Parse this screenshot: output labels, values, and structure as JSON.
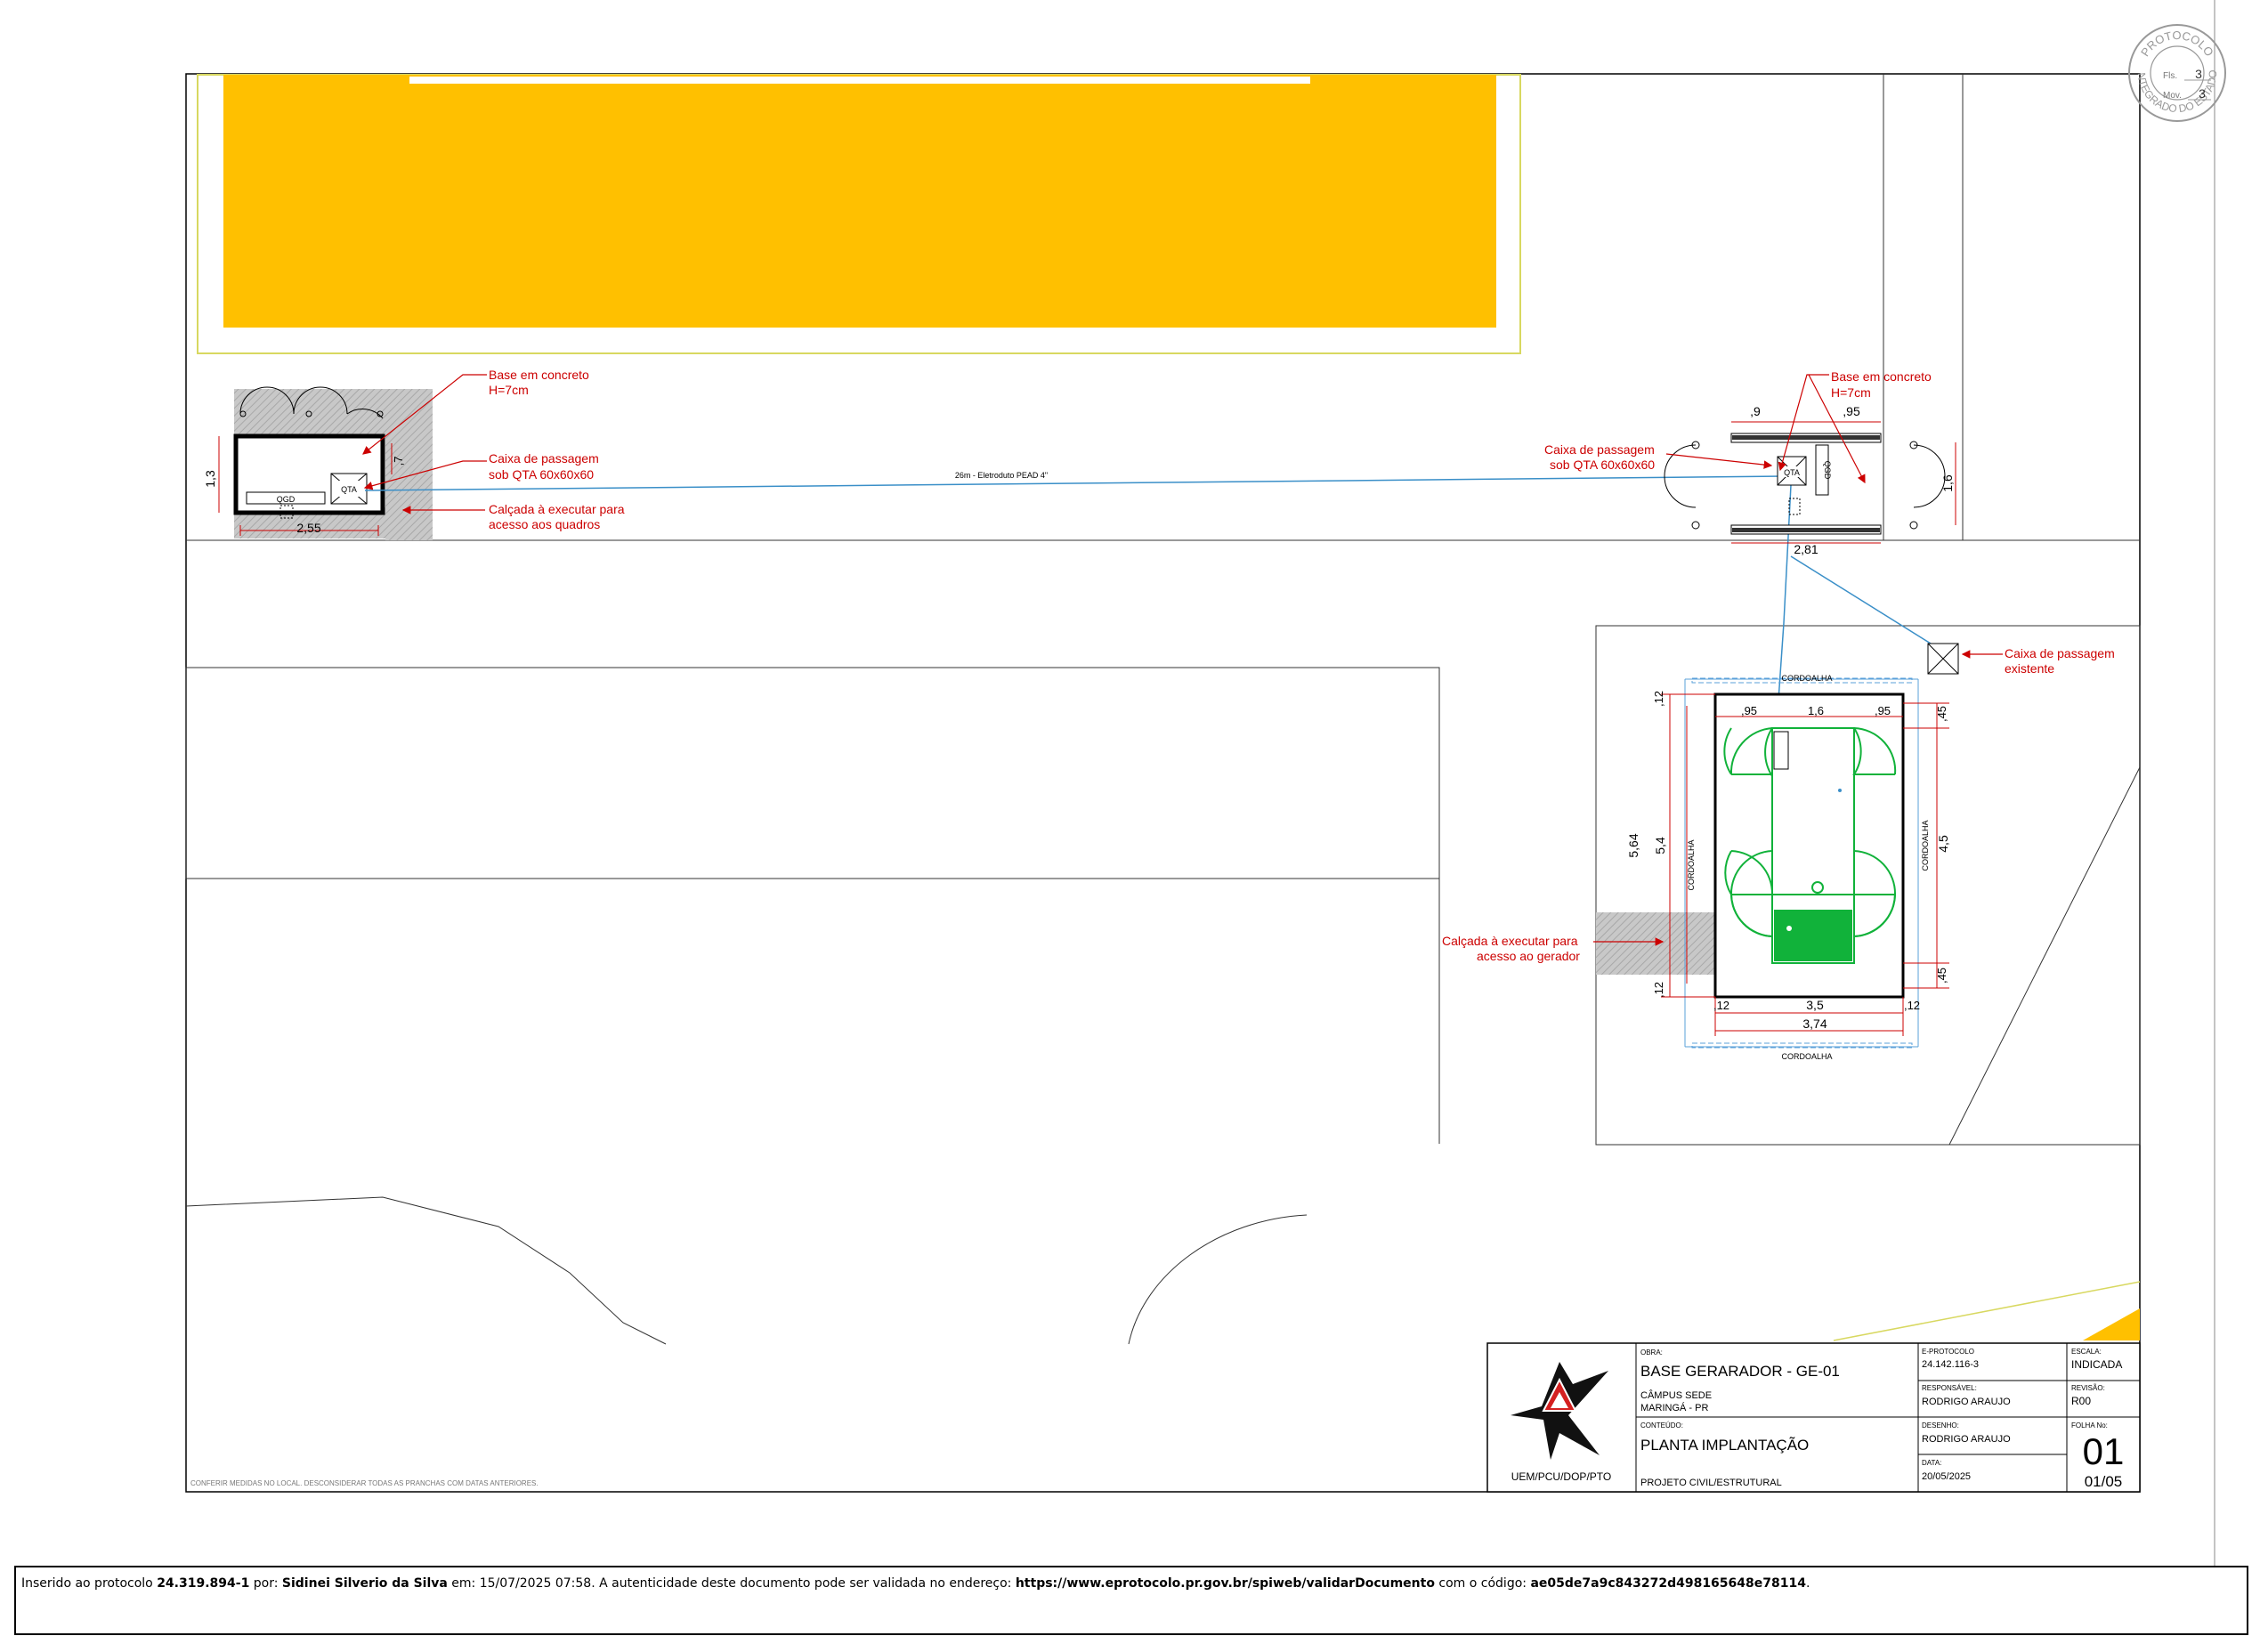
{
  "stamp": {
    "ring_top": "PROTOCOLO",
    "ring_bottom": "INTEGRADO DO ESTADO",
    "fls_label": "Fls.",
    "fls_value": "3",
    "mov_label": "Mov.",
    "mov_value": "3"
  },
  "annotations": {
    "base_left_l1": "Base em concreto",
    "base_left_l2": "H=7cm",
    "caixa_left_l1": "Caixa de passagem",
    "caixa_left_l2": "sob QTA 60x60x60",
    "calcada_left_l1": "Calçada à executar para",
    "calcada_left_l2": "acesso aos quadros",
    "base_right_l1": "Base em concreto",
    "base_right_l2": "H=7cm",
    "caixa_right_l1": "Caixa de passagem",
    "caixa_right_l2": "sob QTA 60x60x60",
    "caixa_exist_l1": "Caixa de passagem",
    "caixa_exist_l2": "existente",
    "calcada_right_l1": "Calçada à executar para",
    "calcada_right_l2": "acesso ao gerador",
    "conduit": "26m - Eletroduto PEAD 4\"",
    "general_note": "CONFERIR MEDIDAS NO LOCAL. DESCONSIDERAR TODAS AS PRANCHAS COM DATAS ANTERIORES."
  },
  "labels": {
    "qgd": "QGD",
    "qta": "QTA",
    "cordoalha": "CORDOALHA"
  },
  "dimensions": {
    "left_width": "2,55",
    "left_height": "1,3",
    "left_small": ",7",
    "right_top_a": ",9",
    "right_top_b": ",95",
    "right_width": "2,81",
    "right_height": "1,6",
    "gen_top_a": ",95",
    "gen_top_b": "1,6",
    "gen_top_c": ",95",
    "gen_left_total": "5,64",
    "gen_left_inner": "5,4",
    "gen_left_12_top": ",12",
    "gen_left_12_bot": ",12",
    "gen_right_45_top": ",45",
    "gen_right_45": "4,5",
    "gen_right_45_bot": ",45",
    "gen_bottom_inner": "3,5",
    "gen_bottom_total": "3,74",
    "gen_bottom_12_l": ",12",
    "gen_bottom_12_r": ",12"
  },
  "title_block": {
    "org": "UEM/PCU/DOP/PTO",
    "obra_label": "OBRA:",
    "obra": "BASE GERARADOR - GE-01",
    "campus": "CÂMPUS SEDE",
    "city": "MARINGÁ - PR",
    "conteudo_label": "CONTEÚDO:",
    "conteudo": "PLANTA IMPLANTAÇÃO",
    "project_type": "PROJETO CIVIL/ESTRUTURAL",
    "eprotocolo_label": "E-PROTOCOLO",
    "eprotocolo": "24.142.116-3",
    "escala_label": "ESCALA:",
    "escala": "INDICADA",
    "responsavel_label": "RESPONSÁVEL:",
    "responsavel": "RODRIGO ARAUJO",
    "revisao_label": "REVISÃO:",
    "revisao": "R00",
    "desenho_label": "DESENHO:",
    "desenho": "RODRIGO ARAUJO",
    "folha_label": "FOLHA No:",
    "folha": "01",
    "folha_total": "01/05",
    "data_label": "DATA:",
    "data": "20/05/2025"
  },
  "footer": {
    "t1": "Inserido ao protocolo ",
    "protocol": "24.319.894-1",
    "t2": " por: ",
    "author": "Sidinei Silverio da Silva",
    "t3": " em: 15/07/2025 07:58. A autenticidade deste documento pode ser validada no endereço: ",
    "url": "https://www.eprotocolo.pr.gov.br/spiweb/validarDocumento",
    "t4": " com o código: ",
    "code": "ae05de7a9c843272d498165648e78114",
    "t5": "."
  },
  "colors": {
    "yellow": "#FFC000",
    "red_annotation": "#CC0000",
    "blue_conduit": "#3A8FC8",
    "green_generator": "#11B23A",
    "gray_hatch": "#BFBFBF"
  }
}
